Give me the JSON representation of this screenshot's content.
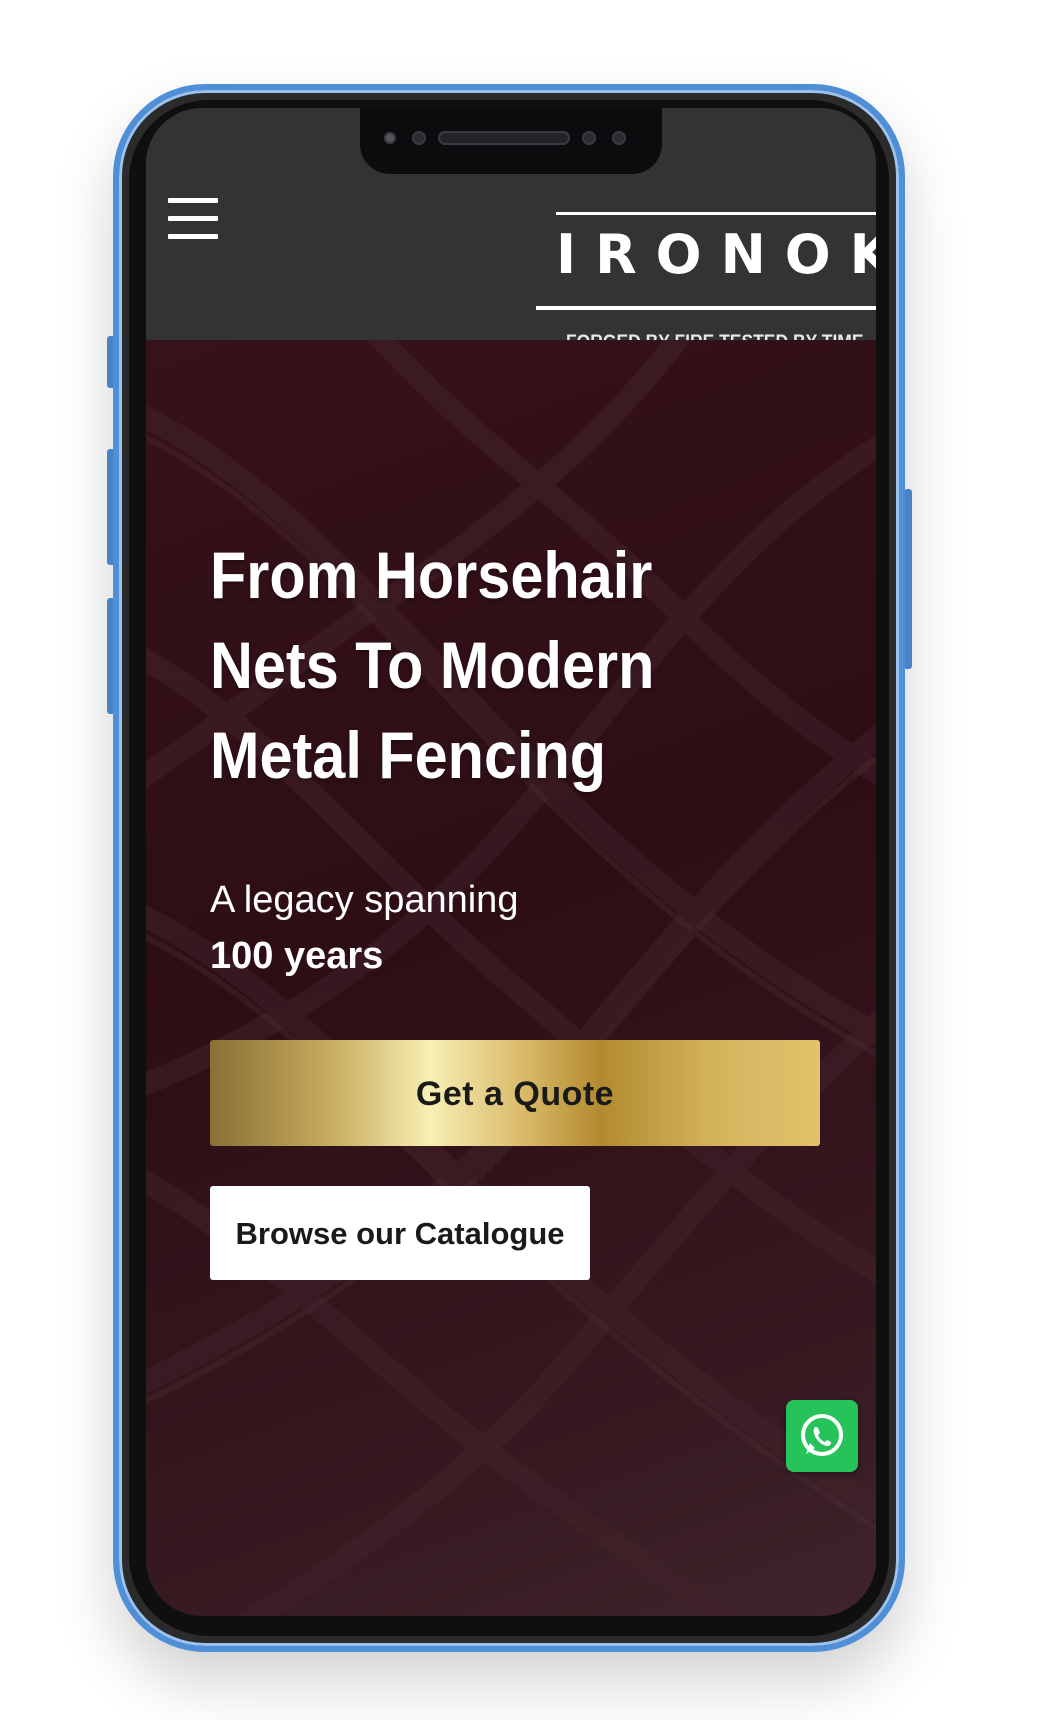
{
  "brand": {
    "logo_text": "IRONOK",
    "tagline": "FORGED BY FIRE TESTED BY TIME"
  },
  "header": {
    "menu_icon": "hamburger-menu-icon"
  },
  "hero": {
    "title": "From Horsehair Nets To Modern Metal Fencing",
    "subtitle_line1": "A legacy spanning",
    "subtitle_line2": "100 years",
    "primary_button": "Get a Quote",
    "secondary_button": "Browse our Catalogue"
  },
  "floating": {
    "whatsapp_icon": "whatsapp-icon"
  },
  "colors": {
    "header_bg": "#333333",
    "hero_bg": "#2e0f15",
    "gold_accent": "#d8b867",
    "phone_frame": "#4f8fd8",
    "whatsapp_green": "#25c35a"
  }
}
